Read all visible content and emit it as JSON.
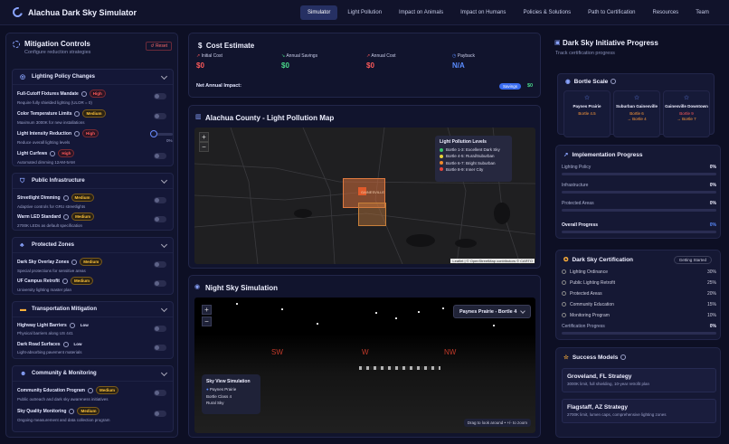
{
  "brand": {
    "title": "Alachua Dark Sky Simulator"
  },
  "nav": {
    "items": [
      "Simulator",
      "Light Pollution",
      "Impact on Animals",
      "Impact on Humans",
      "Policies & Solutions",
      "Path to Certification",
      "Resources",
      "Team"
    ],
    "active": "Simulator"
  },
  "mitigation": {
    "title": "Mitigation Controls",
    "subtitle": "Configure reduction strategies",
    "reset_label": "Reset",
    "groups": [
      {
        "title": "Lighting Policy Changes",
        "items": [
          {
            "title": "Full-Cutoff Fixtures Mandate",
            "badge": "High",
            "desc": "Require fully shielded lighting (ULOR = 0)"
          },
          {
            "title": "Color Temperature Limits",
            "badge": "Medium",
            "desc": "Maximum 3000K for new installations"
          },
          {
            "title": "Light Intensity Reduction",
            "badge": "High",
            "desc": "Reduce overall lighting levels",
            "value": "0%"
          },
          {
            "title": "Light Curfews",
            "badge": "High",
            "desc": "Automated dimming 12AM-5AM"
          }
        ]
      },
      {
        "title": "Public Infrastructure",
        "items": [
          {
            "title": "Streetlight Dimming",
            "badge": "Medium",
            "desc": "Adaptive controls for GRU streetlights"
          },
          {
            "title": "Warm LED Standard",
            "badge": "Medium",
            "desc": "2700K LEDs as default specification"
          }
        ]
      },
      {
        "title": "Protected Zones",
        "items": [
          {
            "title": "Dark Sky Overlay Zones",
            "badge": "Medium",
            "desc": "Special protections for sensitive areas"
          },
          {
            "title": "UF Campus Retrofit",
            "badge": "Medium",
            "desc": "University lighting master plan"
          }
        ]
      },
      {
        "title": "Transportation Mitigation",
        "items": [
          {
            "title": "Highway Light Barriers",
            "badge": "Low",
            "desc": "Physical barriers along US 441"
          },
          {
            "title": "Dark Road Surfaces",
            "badge": "Low",
            "desc": "Light-absorbing pavement materials"
          }
        ]
      },
      {
        "title": "Community & Monitoring",
        "items": [
          {
            "title": "Community Education Program",
            "badge": "Medium",
            "desc": "Public outreach and dark sky awareness initiatives"
          },
          {
            "title": "Sky Quality Monitoring",
            "badge": "Medium",
            "desc": "Ongoing measurement and data collection program"
          }
        ]
      }
    ]
  },
  "cost": {
    "title": "Cost Estimate",
    "items": [
      {
        "label": "Initial Cost",
        "value": "$0"
      },
      {
        "label": "Annual Savings",
        "value": "$0"
      },
      {
        "label": "Annual Cost",
        "value": "$0"
      },
      {
        "label": "Payback",
        "value": "N/A"
      }
    ],
    "net_label": "Net Annual Impact:",
    "net_pill": "Savings",
    "net_value": "$0"
  },
  "map": {
    "title": "Alachua County - Light Pollution Map",
    "city_label": "GAINESVILLE",
    "legend_title": "Light Pollution Levels",
    "legend": [
      {
        "label": "Bortle 1-3: Excellent Dark Sky",
        "color": "#3ac46a"
      },
      {
        "label": "Bortle 4-5: Rural/Suburban",
        "color": "#e8d23a"
      },
      {
        "label": "Bortle 6-7: Bright Suburban",
        "color": "#f08a2a"
      },
      {
        "label": "Bortle 8-9: Inner City",
        "color": "#e8443a"
      }
    ],
    "attribution": "Leaflet | © OpenStreetMap contributors © CARTO",
    "zoom_in": "+",
    "zoom_out": "−"
  },
  "sky": {
    "title": "Night Sky Simulation",
    "location": "Paynes Prairie - Bortle 4",
    "compass": [
      "SW",
      "W",
      "NW"
    ],
    "info_title": "Sky View Simulation",
    "info_location": "Paynes Prairie",
    "info_class": "Bortle Class 4",
    "info_type": "Rural Sky",
    "hint": "Drag to look around • +/- to zoom"
  },
  "initiative": {
    "title": "Dark Sky Initiative Progress",
    "subtitle": "Track certification progress",
    "bortle_title": "Bortle Scale",
    "locations": [
      {
        "name": "Paynes Prairie",
        "value": "Bortle 4.5"
      },
      {
        "name": "Suburban Gainesville",
        "value": "Bortle 6",
        "target": "→ Bortle 4"
      },
      {
        "name": "Gainesville Downtown",
        "value": "Bortle 9",
        "target": "→ Bortle 7"
      }
    ]
  },
  "implementation": {
    "title": "Implementation Progress",
    "rows": [
      {
        "label": "Lighting Policy",
        "pct": "0%",
        "value": 0
      },
      {
        "label": "Infrastructure",
        "pct": "0%",
        "value": 0
      },
      {
        "label": "Protected Areas",
        "pct": "0%",
        "value": 0
      },
      {
        "label": "Overall Progress",
        "pct": "0%",
        "value": 0
      }
    ]
  },
  "certification": {
    "title": "Dark Sky Certification",
    "status": "Getting Started",
    "rows": [
      {
        "label": "Lighting Ordinance",
        "pct": "30%"
      },
      {
        "label": "Public Lighting Retrofit",
        "pct": "25%"
      },
      {
        "label": "Protected Areas",
        "pct": "20%"
      },
      {
        "label": "Community Education",
        "pct": "15%"
      },
      {
        "label": "Monitoring Program",
        "pct": "10%"
      }
    ],
    "progress_label": "Certification Progress",
    "progress_pct": "0%",
    "progress_value": 0
  },
  "success": {
    "title": "Success Models",
    "models": [
      {
        "title": "Groveland, FL Strategy",
        "desc": "3000K limit, full shielding, 10-year retrofit plan"
      },
      {
        "title": "Flagstaff, AZ Strategy",
        "desc": "2700K limit, lumen caps, comprehensive lighting zones"
      }
    ]
  }
}
